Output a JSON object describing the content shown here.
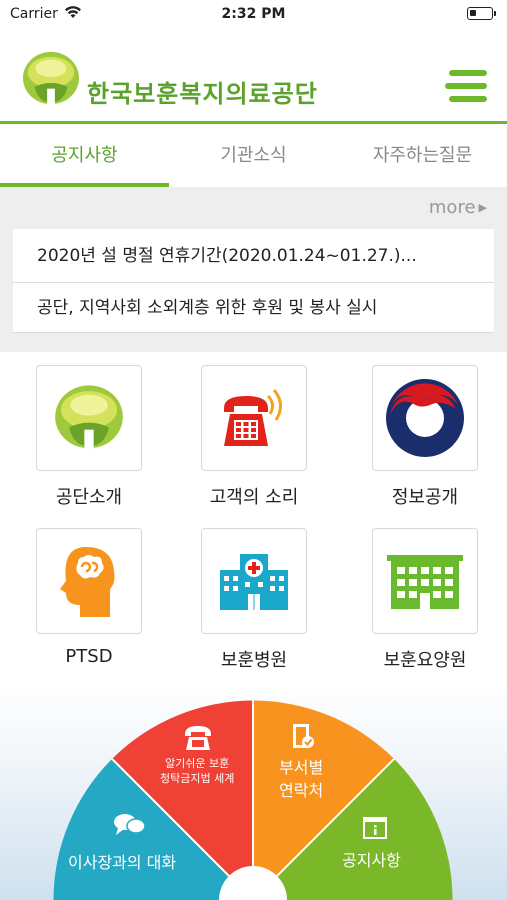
{
  "status_bar": {
    "carrier": "Carrier",
    "time": "2:32 PM"
  },
  "header": {
    "brand": "한국보훈복지의료공단"
  },
  "tabs": [
    {
      "label": "공지사항",
      "active": true
    },
    {
      "label": "기관소식",
      "active": false
    },
    {
      "label": "자주하는질문",
      "active": false
    }
  ],
  "notices": {
    "more_label": "more",
    "items": [
      "2020년 설 명절 연휴기간(2020.01.24~01.27.)...",
      "공단, 지역사회 소외계층 위한 후원 및 봉사 실시"
    ]
  },
  "grid": [
    {
      "label": "공단소개",
      "icon": "organization-logo-icon"
    },
    {
      "label": "고객의 소리",
      "icon": "telephone-icon"
    },
    {
      "label": "정보공개",
      "icon": "taegeuk-icon"
    },
    {
      "label": "PTSD",
      "icon": "brain-head-icon"
    },
    {
      "label": "보훈병원",
      "icon": "hospital-icon"
    },
    {
      "label": "보훈요양원",
      "icon": "nursing-home-icon"
    }
  ],
  "fan_menu": [
    {
      "label": "이사장과의 대화",
      "icon": "chat-bubbles-icon",
      "color": "#25a8c4"
    },
    {
      "label_line1": "알기쉬운 보훈",
      "label_line2": "청탁금지법 세계",
      "icon": "telephone-icon",
      "color": "#ef4136"
    },
    {
      "label_line1": "부서별",
      "label_line2": "연락처",
      "icon": "contact-book-icon",
      "color": "#f7931e"
    },
    {
      "label": "공지사항",
      "icon": "notice-info-icon",
      "color": "#7ab829"
    }
  ],
  "colors": {
    "brand_green": "#6db92b",
    "brand_text": "#5aa22a"
  }
}
